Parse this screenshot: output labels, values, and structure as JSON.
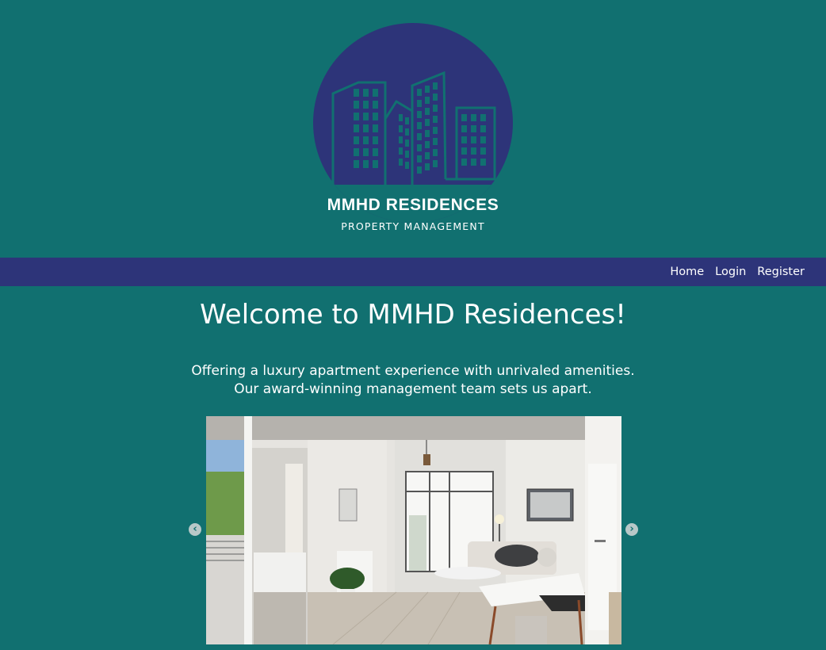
{
  "brand": {
    "name": "MMHD RESIDENCES",
    "subtitle": "PROPERTY MANAGEMENT"
  },
  "nav": {
    "items": [
      {
        "label": "Home"
      },
      {
        "label": "Login"
      },
      {
        "label": "Register"
      }
    ]
  },
  "main": {
    "title": "Welcome to MMHD Residences!",
    "intro_line1": "Offering a luxury apartment experience with unrivaled amenities.",
    "intro_line2": "Our award-winning management team sets us apart."
  },
  "carousel": {
    "prev_icon": "chevron-left-icon",
    "next_icon": "chevron-right-icon",
    "prev_glyph": "‹",
    "next_glyph": "›"
  },
  "colors": {
    "background": "#117070",
    "navbar": "#2d3479",
    "logo_circle": "#2d3479",
    "text": "#ffffff"
  }
}
